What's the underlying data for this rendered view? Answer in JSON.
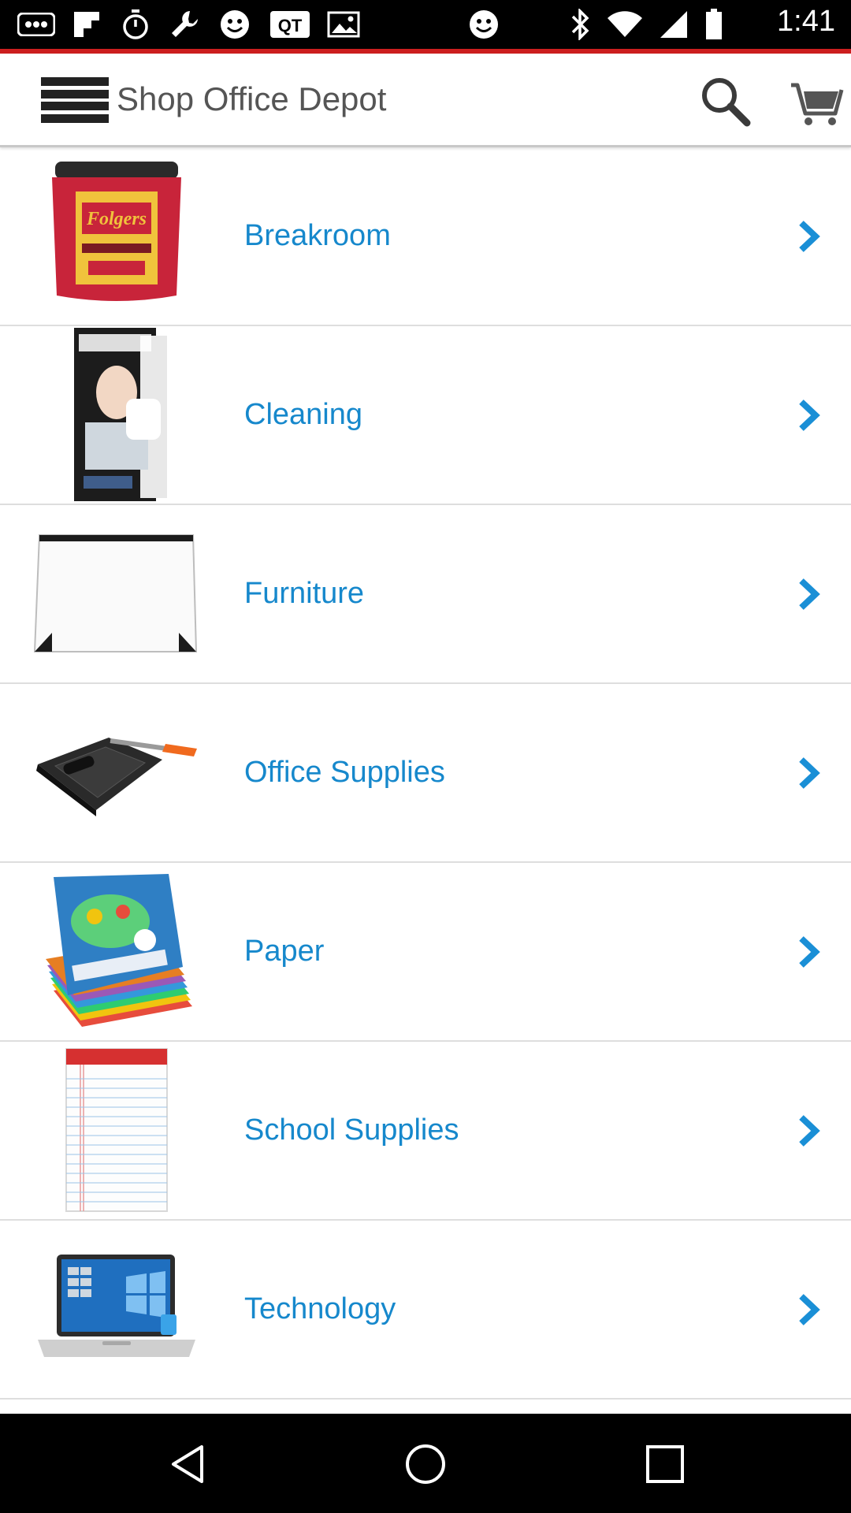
{
  "status_bar": {
    "time": "1:41",
    "icons": [
      "more-icon",
      "flipboard-icon",
      "timer-icon",
      "wrench-icon",
      "smiley-icon",
      "qt-icon",
      "photo-icon",
      "smiley-icon",
      "bluetooth-icon",
      "wifi-icon",
      "signal-icon",
      "battery-icon"
    ]
  },
  "app_bar": {
    "title": "Shop Office Depot",
    "menu_icon": "menu-icon",
    "search_icon": "search-icon",
    "cart_icon": "cart-icon"
  },
  "categories": [
    {
      "label": "Breakroom",
      "image": "coffee-canister-image"
    },
    {
      "label": "Cleaning",
      "image": "thermometer-filters-box-image"
    },
    {
      "label": "Furniture",
      "image": "desk-pad-image"
    },
    {
      "label": "Office Supplies",
      "image": "paper-trimmer-image"
    },
    {
      "label": "Paper",
      "image": "construction-paper-pack-image"
    },
    {
      "label": "School Supplies",
      "image": "legal-notepad-image"
    },
    {
      "label": "Technology",
      "image": "laptop-image"
    }
  ],
  "colors": {
    "accent": "#cc1e1e",
    "link": "#1688cc",
    "chevron": "#1a8fd6"
  },
  "nav_bar": {
    "back_icon": "back-icon",
    "home_icon": "home-icon",
    "recents_icon": "recents-icon"
  }
}
